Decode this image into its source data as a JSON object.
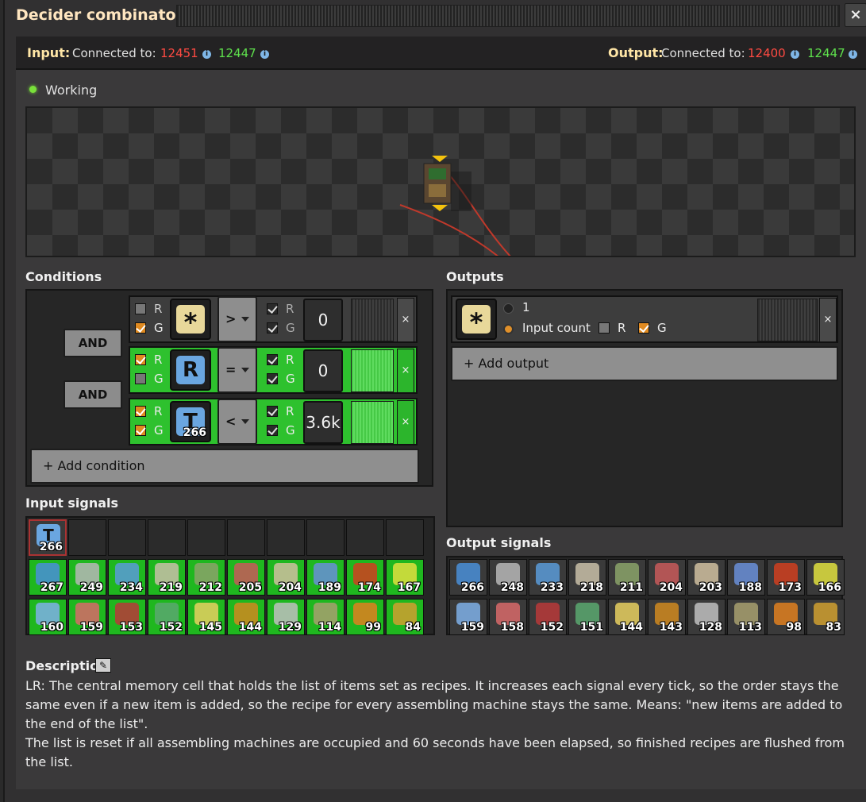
{
  "window": {
    "title": "Decider combinator",
    "close_label": "×"
  },
  "connections": {
    "input_label": "Input:",
    "input_connected": "Connected to:",
    "input_red": "12451",
    "input_green": "12447",
    "output_label": "Output:",
    "output_connected": "Connected to:",
    "output_red": "12400",
    "output_green": "12447",
    "info_glyph": "i"
  },
  "status": {
    "text": "Working",
    "color": "#79e03a"
  },
  "conditions": {
    "header": "Conditions",
    "and_labels": [
      "AND",
      "AND"
    ],
    "rows": [
      {
        "left_signal": "*",
        "left_signal_count": "",
        "comparator": ">",
        "right_value": "0",
        "left_r": false,
        "left_g": true,
        "right_r": true,
        "right_g": true,
        "active": false
      },
      {
        "left_signal": "R",
        "left_signal_count": "",
        "comparator": "=",
        "right_value": "0",
        "left_r": true,
        "left_g": false,
        "right_r": true,
        "right_g": true,
        "active": true
      },
      {
        "left_signal": "T",
        "left_signal_count": "266",
        "comparator": "<",
        "right_value": "3.6k",
        "left_r": true,
        "left_g": true,
        "right_r": true,
        "right_g": true,
        "active": true
      }
    ],
    "r_label": "R",
    "g_label": "G",
    "remove_glyph": "×",
    "add_label": "+ Add condition"
  },
  "outputs": {
    "header": "Outputs",
    "signal": "*",
    "option_constant": "1",
    "option_input_count": "Input count",
    "r_label": "R",
    "g_label": "G",
    "remove_glyph": "×",
    "add_label": "+ Add output"
  },
  "input_signals": {
    "header": "Input signals",
    "row0": [
      {
        "icon": "signal-T",
        "count": "266"
      }
    ],
    "row1": [
      "267",
      "249",
      "234",
      "219",
      "212",
      "205",
      "204",
      "189",
      "174",
      "167"
    ],
    "row2": [
      "160",
      "159",
      "153",
      "152",
      "145",
      "144",
      "129",
      "114",
      "99",
      "84"
    ]
  },
  "output_signals": {
    "header": "Output signals",
    "row1": [
      "266",
      "248",
      "233",
      "218",
      "211",
      "204",
      "203",
      "188",
      "173",
      "166"
    ],
    "row2": [
      "159",
      "158",
      "152",
      "151",
      "144",
      "143",
      "128",
      "113",
      "98",
      "83"
    ]
  },
  "description": {
    "header": "Description",
    "line1": "LR: The central memory cell that holds the list of items set as recipes. It increases each signal every tick, so the order stays the same even if a new item is added, so the recipe for every assembling machine stays the same. Means: \"new items are added to the end of the list\".",
    "line2": "The list is reset if all assembling machines are occupied and 60 seconds have been elapsed, so finished recipes are flushed from the list."
  },
  "colors": {
    "red_wire": "#ff4a42",
    "green_wire": "#5ee04c",
    "active_row": "#2ec12e",
    "checkbox_on": "#e08a20"
  },
  "icon_names": [
    "speed-module-icon",
    "stone-brick-icon",
    "pipe-icon",
    "spidertron-icon",
    "solar-panel-icon",
    "battery-icon",
    "lab-icon",
    "electric-engine-icon",
    "boiler-icon",
    "plastic-icon",
    "barrel-icon",
    "chest-icon",
    "rail-icon",
    "assembler-icon",
    "belt-icon",
    "robot-icon",
    "inserter-icon",
    "pump-icon",
    "radar-icon",
    "miner-icon"
  ]
}
